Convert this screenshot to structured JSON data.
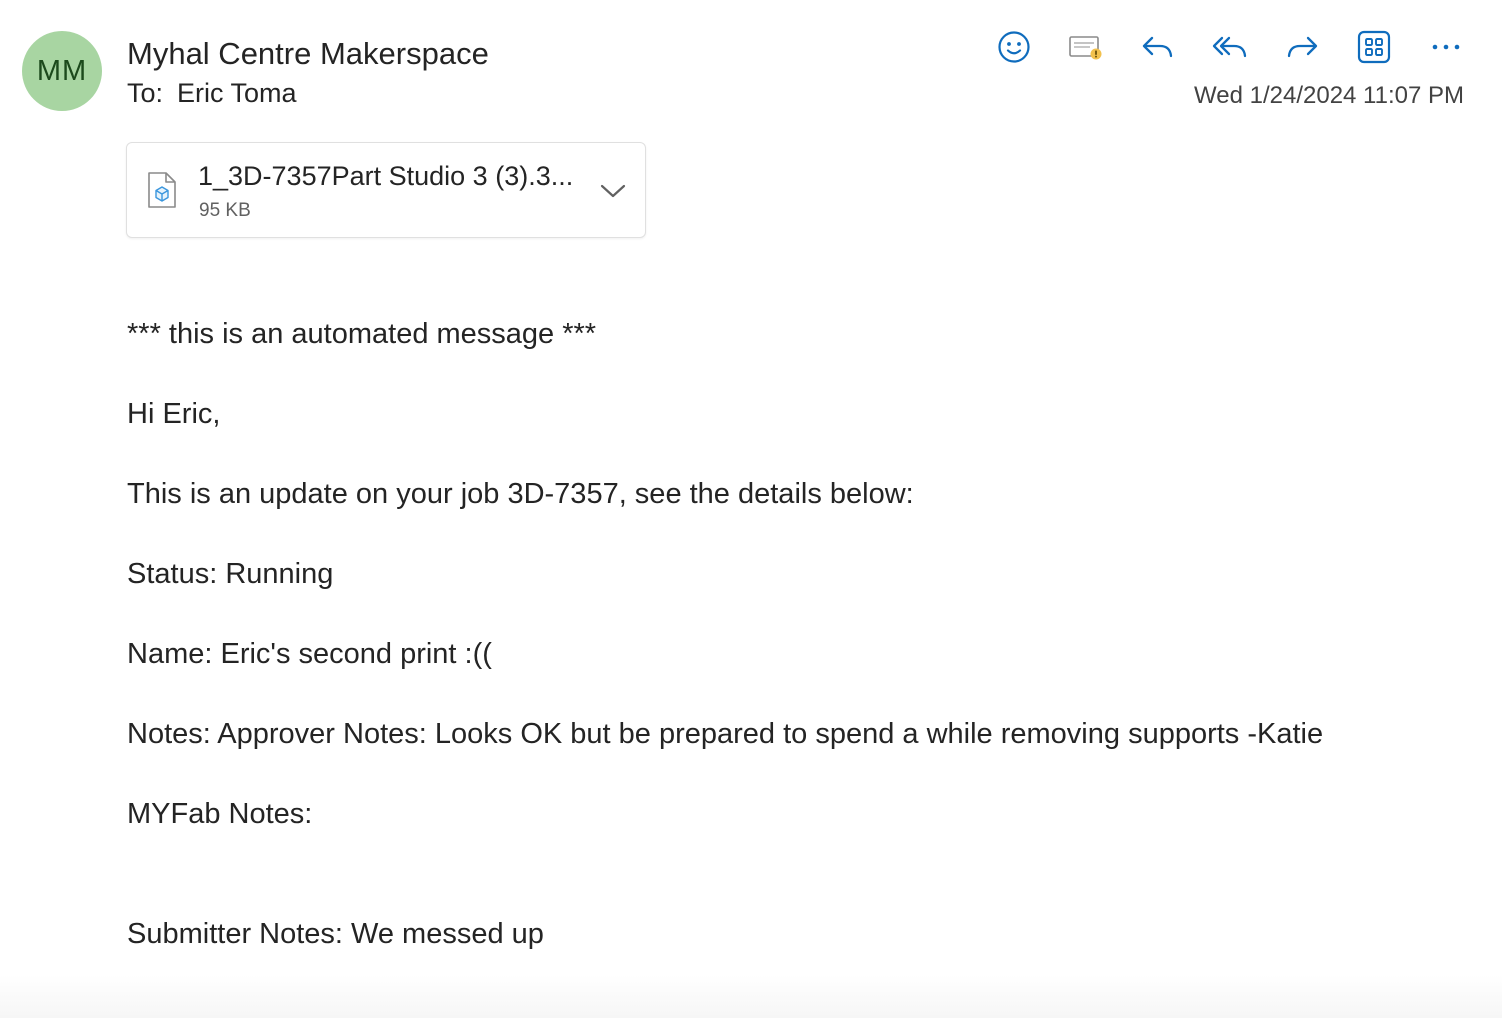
{
  "sender": {
    "initials": "MM",
    "avatar_color": "#a8d5a2",
    "name": "Myhal Centre Makerspace"
  },
  "recipients": {
    "label": "To:",
    "value": "Eric Toma"
  },
  "toolbar": {
    "buttons": [
      {
        "icon": "emoji-smile-icon"
      },
      {
        "icon": "mail-warning-icon"
      },
      {
        "icon": "reply-icon"
      },
      {
        "icon": "reply-all-icon"
      },
      {
        "icon": "forward-icon"
      },
      {
        "icon": "apps-grid-icon"
      },
      {
        "icon": "more-options-icon"
      }
    ],
    "accent_color": "#0f6cbd"
  },
  "timestamp": "Wed 1/24/2024 11:07 PM",
  "attachment": {
    "file_name": "1_3D-7357Part Studio 3 (3).3...",
    "file_size": "95 KB",
    "icon": "3d-file-icon"
  },
  "body": {
    "automated_notice": "*** this is an automated message ***",
    "greeting": "Hi Eric,",
    "intro": "This is an update on your job 3D-7357, see the details below:",
    "status": "Status: Running",
    "name": "Name: Eric's second print :((",
    "notes": "Notes: Approver Notes: Looks OK but be prepared to spend a while removing supports -Katie",
    "myfab_notes": "MYFab Notes:",
    "submitter_notes": "Submitter Notes: We messed up"
  }
}
